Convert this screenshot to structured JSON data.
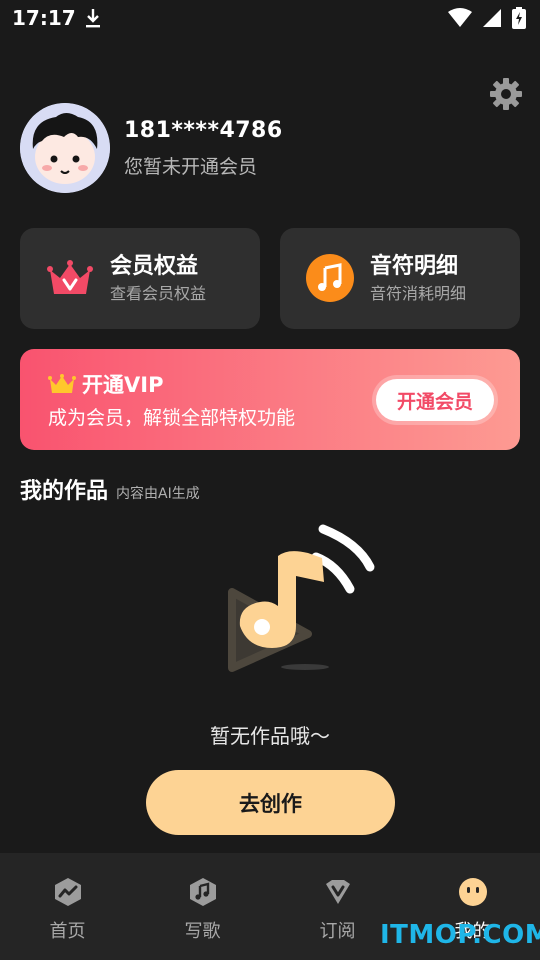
{
  "status_bar": {
    "time": "17:17",
    "download_icon": "download-arrow-icon",
    "wifi_icon": "wifi-icon",
    "signal_icon": "signal-icon",
    "battery_icon": "battery-charging-icon"
  },
  "header": {
    "settings_icon": "gear-icon"
  },
  "profile": {
    "phone": "181****4786",
    "member_status": "您暂未开通会员"
  },
  "cards": [
    {
      "title": "会员权益",
      "subtitle": "查看会员权益",
      "icon": "crown-icon"
    },
    {
      "title": "音符明细",
      "subtitle": "音符消耗明细",
      "icon": "music-note-icon"
    }
  ],
  "vip_banner": {
    "title": "开通VIP",
    "subtitle": "成为会员，解锁全部特权功能",
    "button_label": "开通会员",
    "icon": "crown-emoji-icon"
  },
  "works": {
    "title": "我的作品",
    "subtitle": "内容由AI生成",
    "empty_text": "暂无作品哦～",
    "create_button": "去创作"
  },
  "bottom_nav": {
    "items": [
      {
        "label": "首页",
        "icon": "home-chart-icon",
        "active": false
      },
      {
        "label": "写歌",
        "icon": "song-note-icon",
        "active": false
      },
      {
        "label": "订阅",
        "icon": "subscribe-v-icon",
        "active": false
      },
      {
        "label": "我的",
        "icon": "profile-face-icon",
        "active": true
      }
    ]
  },
  "watermark": "ITMOP.COM",
  "colors": {
    "background": "#1a1a1a",
    "card": "#2f2f2f",
    "vip_gradient_start": "#f9536f",
    "vip_gradient_end": "#fd9a92",
    "create_button": "#fdd394",
    "note_orange": "#fb8c1a",
    "crown_red": "#f24a66"
  }
}
